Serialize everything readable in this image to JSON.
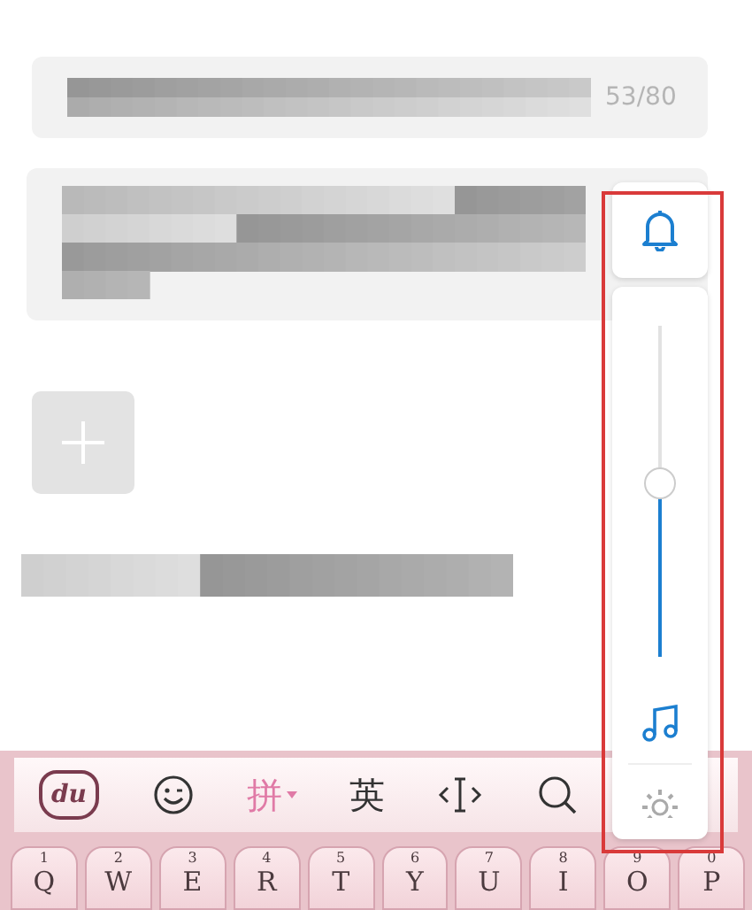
{
  "form": [
    {
      "kind": "blurred-input",
      "counter": "53/80"
    },
    {
      "kind": "blurred-textarea"
    },
    {
      "kind": "add-tile"
    },
    {
      "kind": "blurred-note"
    }
  ],
  "volume_panel": {
    "level": 0.53
  },
  "annotation": {
    "kind": "frame"
  },
  "keyboard": {
    "toolbar": [
      {
        "kind": "logo",
        "label": "du",
        "selected": false
      },
      {
        "kind": "emoji",
        "selected": false
      },
      {
        "kind": "text",
        "label": "拼",
        "caret": true,
        "selected": true
      },
      {
        "kind": "text",
        "label": "英",
        "selected": false
      },
      {
        "kind": "cursor",
        "selected": false
      },
      {
        "kind": "search",
        "selected": false
      }
    ],
    "keys": [
      {
        "hint": "1",
        "label": "Q"
      },
      {
        "hint": "2",
        "label": "W"
      },
      {
        "hint": "3",
        "label": "E"
      },
      {
        "hint": "4",
        "label": "R"
      },
      {
        "hint": "5",
        "label": "T"
      },
      {
        "hint": "6",
        "label": "Y"
      },
      {
        "hint": "7",
        "label": "U"
      },
      {
        "hint": "8",
        "label": "I"
      },
      {
        "hint": "9",
        "label": "O"
      },
      {
        "hint": "0",
        "label": "P"
      }
    ]
  }
}
